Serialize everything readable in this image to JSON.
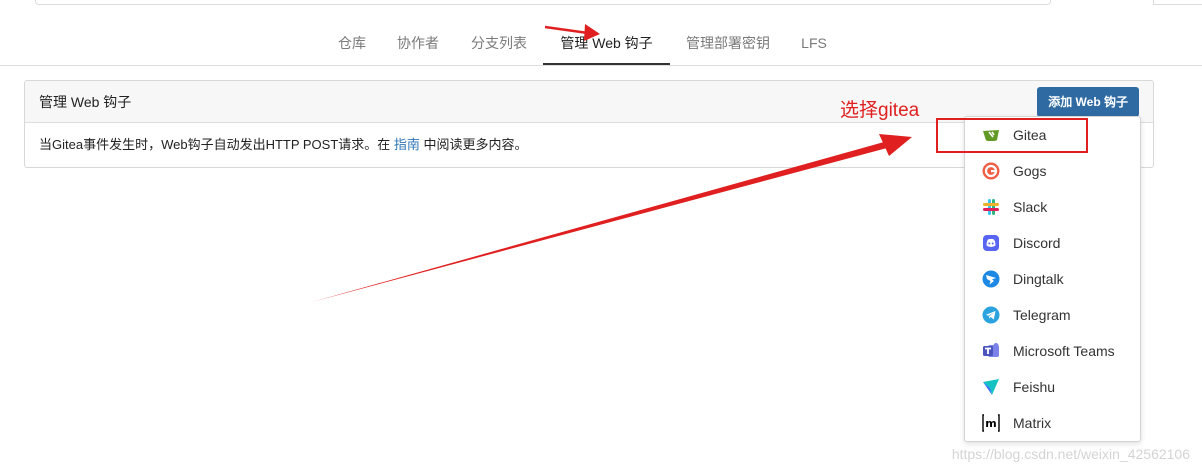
{
  "tabs": [
    {
      "label": "仓库"
    },
    {
      "label": "协作者"
    },
    {
      "label": "分支列表"
    },
    {
      "label": "管理 Web 钩子",
      "active": true
    },
    {
      "label": "管理部署密钥"
    },
    {
      "label": "LFS"
    }
  ],
  "panel": {
    "title": "管理 Web 钩子",
    "add_button": "添加 Web 钩子",
    "description_before": "当Gitea事件发生时，Web钩子自动发出HTTP POST请求。在",
    "guide_link": "指南",
    "description_after": "中阅读更多内容。"
  },
  "menu": {
    "items": [
      {
        "label": "Gitea",
        "icon": "gitea-icon",
        "color": "#609926"
      },
      {
        "label": "Gogs",
        "icon": "gogs-icon",
        "color": "#f05f45"
      },
      {
        "label": "Slack",
        "icon": "slack-icon",
        "color": "#4a154b"
      },
      {
        "label": "Discord",
        "icon": "discord-icon",
        "color": "#5865f2"
      },
      {
        "label": "Dingtalk",
        "icon": "dingtalk-icon",
        "color": "#1e88e5"
      },
      {
        "label": "Telegram",
        "icon": "telegram-icon",
        "color": "#2aa3df"
      },
      {
        "label": "Microsoft Teams",
        "icon": "teams-icon",
        "color": "#5b5fc7"
      },
      {
        "label": "Feishu",
        "icon": "feishu-icon",
        "color": "#14c3c1"
      },
      {
        "label": "Matrix",
        "icon": "matrix-icon",
        "color": "#000000"
      }
    ]
  },
  "annotation": {
    "text": "选择gitea",
    "color": "#e02020"
  },
  "watermark": "https://blog.csdn.net/weixin_42562106",
  "colors": {
    "primary_button": "#2f6ba2",
    "link": "#2d74b5",
    "annotation_red": "#e02020"
  }
}
